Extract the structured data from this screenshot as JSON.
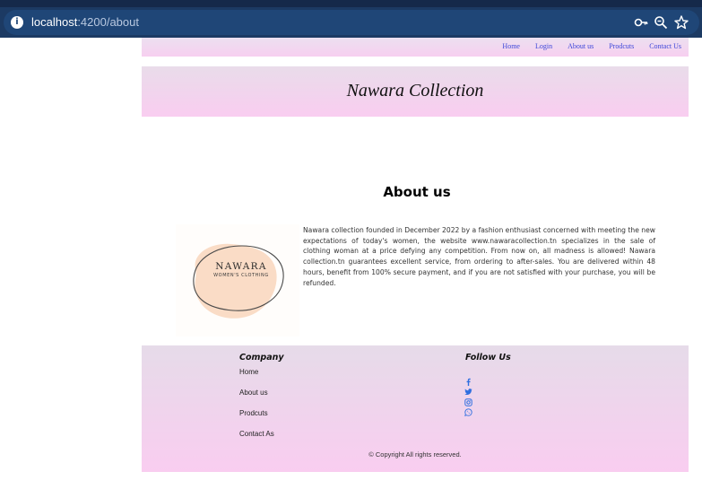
{
  "browser": {
    "url_host": "localhost",
    "url_path": ":4200/about",
    "icons": [
      "info-icon",
      "key-icon",
      "zoom-icon",
      "star-icon"
    ]
  },
  "navbar": {
    "links": [
      "Home",
      "Login",
      "About us",
      "Prodcuts",
      "Contact Us"
    ],
    "link_color": "#3d48d8"
  },
  "hero": {
    "title": "Nawara Collection"
  },
  "about": {
    "heading": "About us",
    "logo_name": "NAWARA",
    "logo_tagline": "WOMEN'S CLOTHING",
    "text": "Nawara collection founded in December 2022 by a fashion enthusiast concerned with meeting the new expectations of today's women, the website www.nawaracollection.tn specializes in the sale of clothing woman at a price defying any competition. From now on, all madness is allowed! Nawara collection.tn guarantees excellent service, from ordering to after-sales. You are delivered within 48 hours, benefit from 100% secure payment, and if you are not satisfied with your purchase, you will be refunded."
  },
  "footer": {
    "company_title": "Company",
    "company_links": [
      "Home",
      "About us",
      "Prodcuts",
      "Contact As"
    ],
    "follow_title": "Follow Us",
    "social_icons": [
      "facebook-icon",
      "twitter-icon",
      "instagram-icon",
      "whatsapp-icon"
    ],
    "social_color": "#2f6fe0",
    "copyright": "© Copyright All rights reserved."
  },
  "colors": {
    "pink_gradient_top": "#ece0f0",
    "pink_gradient_bottom": "#f9cdf0",
    "browser_chrome": "#1c3a63"
  }
}
